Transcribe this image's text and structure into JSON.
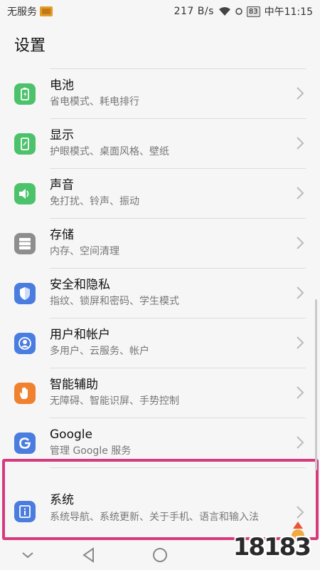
{
  "status_bar": {
    "carrier": "无服务",
    "speed": "217 B/s",
    "battery": "83",
    "time": "中午11:15"
  },
  "header": {
    "title": "设置"
  },
  "items": [
    {
      "title": "电池",
      "subtitle": "省电模式、耗电排行",
      "icon": "battery-icon",
      "color": "#4cc26b"
    },
    {
      "title": "显示",
      "subtitle": "护眼模式、桌面风格、壁纸",
      "icon": "display-icon",
      "color": "#4cc26b"
    },
    {
      "title": "声音",
      "subtitle": "免打扰、铃声、振动",
      "icon": "sound-icon",
      "color": "#4cc26b"
    },
    {
      "title": "存储",
      "subtitle": "内存、空间清理",
      "icon": "storage-icon",
      "color": "#8e8e8e"
    },
    {
      "title": "安全和隐私",
      "subtitle": "指纹、锁屏和密码、学生模式",
      "icon": "shield-icon",
      "color": "#4a7ddf"
    },
    {
      "title": "用户和帐户",
      "subtitle": "多用户、云服务、帐户",
      "icon": "user-icon",
      "color": "#4a7ddf"
    },
    {
      "title": "智能辅助",
      "subtitle": "无障碍、智能识屏、手势控制",
      "icon": "hand-icon",
      "color": "#f0812e"
    },
    {
      "title": "Google",
      "subtitle": "管理 Google 服务",
      "icon": "google-icon",
      "color": "#4a7ddf"
    },
    {
      "title": "系统",
      "subtitle": "系统导航、系统更新、关于手机、语言和输入法",
      "icon": "info-icon",
      "color": "#4a7ddf"
    }
  ],
  "watermark": {
    "text": "18183"
  },
  "colors": {
    "highlight": "#d63b7e",
    "green": "#4cc26b",
    "blue": "#4a7ddf",
    "orange": "#f0812e",
    "gray": "#8e8e8e"
  }
}
